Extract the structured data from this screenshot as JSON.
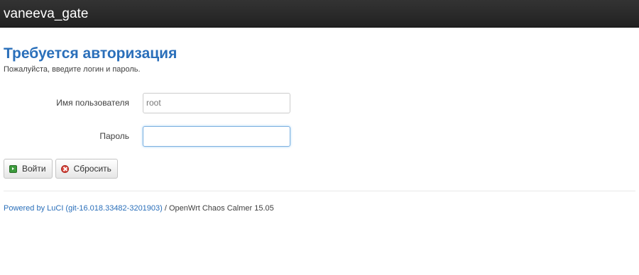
{
  "header": {
    "brand": "vaneeva_gate"
  },
  "main": {
    "title": "Требуется авторизация",
    "subtitle": "Пожалуйста, введите логин и пароль.",
    "username": {
      "label": "Имя пользователя",
      "value": "root"
    },
    "password": {
      "label": "Пароль",
      "value": ""
    },
    "buttons": {
      "login_label": "Войти",
      "reset_label": "Сбросить"
    }
  },
  "footer": {
    "link_text": "Powered by LuCI (git-16.018.33482-3201903)",
    "suffix_text": " / OpenWrt Chaos Calmer 15.05"
  },
  "colors": {
    "accent": "#2a6fba",
    "navbar": "#222222"
  }
}
